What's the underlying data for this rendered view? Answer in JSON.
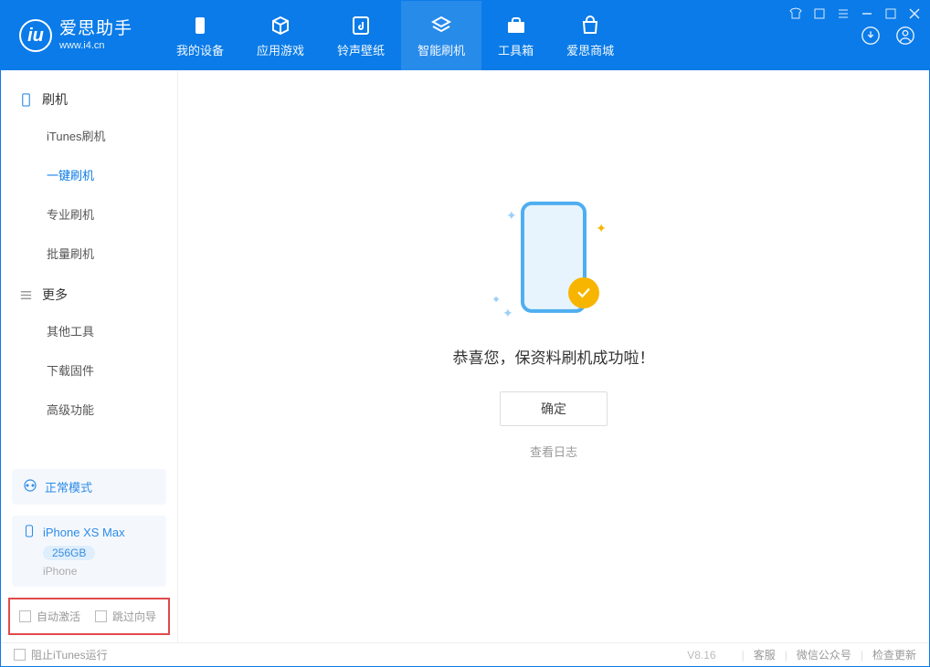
{
  "app": {
    "title": "爱思助手",
    "subtitle": "www.i4.cn"
  },
  "nav": {
    "tabs": [
      {
        "label": "我的设备",
        "icon": "device-icon"
      },
      {
        "label": "应用游戏",
        "icon": "cube-icon"
      },
      {
        "label": "铃声壁纸",
        "icon": "music-icon"
      },
      {
        "label": "智能刷机",
        "icon": "refresh-icon"
      },
      {
        "label": "工具箱",
        "icon": "toolbox-icon"
      },
      {
        "label": "爱思商城",
        "icon": "shop-icon"
      }
    ],
    "activeIndex": 3
  },
  "sidebar": {
    "sections": [
      {
        "label": "刷机",
        "items": [
          {
            "label": "iTunes刷机"
          },
          {
            "label": "一键刷机",
            "active": true
          },
          {
            "label": "专业刷机"
          },
          {
            "label": "批量刷机"
          }
        ]
      },
      {
        "label": "更多",
        "items": [
          {
            "label": "其他工具"
          },
          {
            "label": "下载固件"
          },
          {
            "label": "高级功能"
          }
        ]
      }
    ]
  },
  "deviceStatus": {
    "mode_label": "正常模式",
    "device_name": "iPhone XS Max",
    "capacity": "256GB",
    "device_type": "iPhone"
  },
  "options": {
    "auto_activate_label": "自动激活",
    "skip_wizard_label": "跳过向导"
  },
  "main": {
    "success_message": "恭喜您，保资料刷机成功啦！",
    "ok_button": "确定",
    "view_log": "查看日志"
  },
  "footer": {
    "prevent_itunes_label": "阻止iTunes运行",
    "version": "V8.16",
    "support": "客服",
    "wechat": "微信公众号",
    "check_update": "检查更新"
  }
}
